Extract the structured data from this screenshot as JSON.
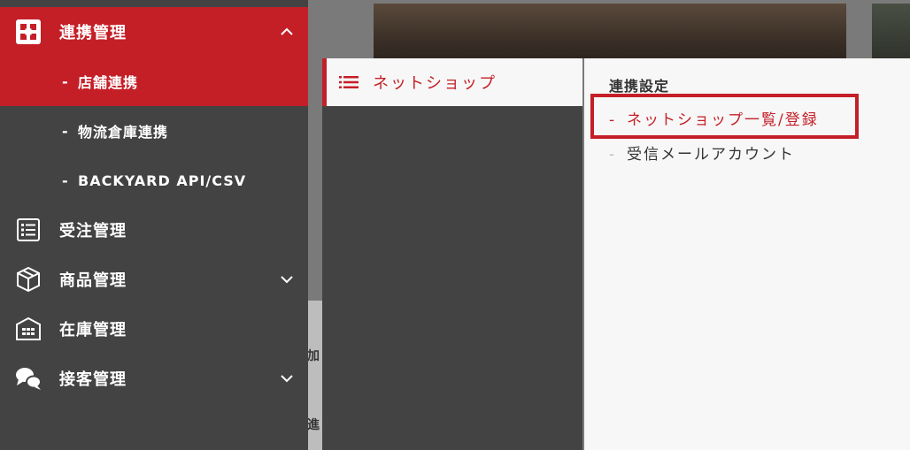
{
  "sidebar": {
    "items": [
      {
        "label": "連携管理",
        "icon": "integration-icon",
        "expanded": true
      },
      {
        "label": "受注管理",
        "icon": "order-list-icon"
      },
      {
        "label": "商品管理",
        "icon": "package-icon"
      },
      {
        "label": "在庫管理",
        "icon": "warehouse-icon"
      },
      {
        "label": "接客管理",
        "icon": "chat-bubbles-icon"
      }
    ],
    "subitems": [
      {
        "label": "店舗連携",
        "dash": "-"
      },
      {
        "label": "物流倉庫連携",
        "dash": "-"
      },
      {
        "label": "BACKYARD API/CSV",
        "dash": "-"
      }
    ]
  },
  "submenu": {
    "active_label": "ネットショップ",
    "icon": "list-icon"
  },
  "panel": {
    "section_title": "連携設定",
    "links": [
      {
        "label": "ネットショップ一覧/登録",
        "dash": "-"
      },
      {
        "label": "受信メールアカウント",
        "dash": "-"
      }
    ]
  },
  "background": {
    "char1": "加",
    "char2": "進"
  },
  "colors": {
    "accent": "#c41f27",
    "sidebar_bg": "#434343",
    "panel_bg": "#f7f7f7"
  }
}
